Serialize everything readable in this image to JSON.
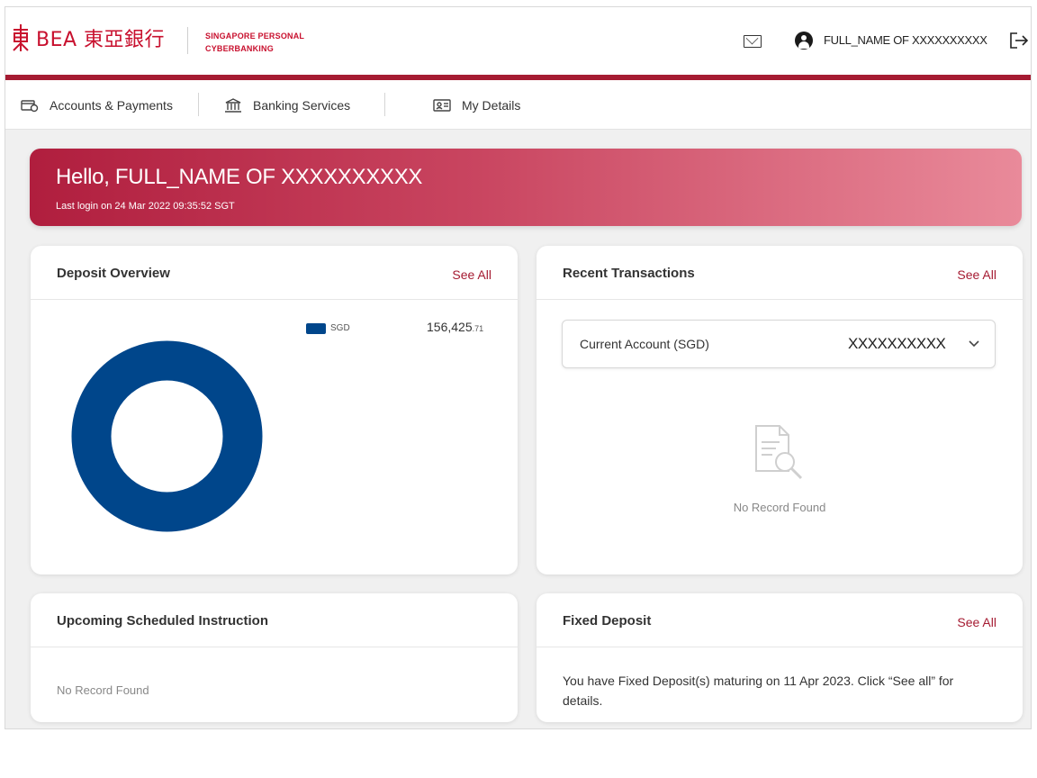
{
  "header": {
    "logo_text": "BEA 東亞銀行",
    "logo_sub_line1": "SINGAPORE PERSONAL",
    "logo_sub_line2": "CYBERBANKING",
    "user_name": "FULL_NAME OF XXXXXXXXXX",
    "icons": [
      "mail-icon",
      "user-icon",
      "logout-icon"
    ]
  },
  "nav": {
    "items": [
      {
        "label": "Accounts & Payments",
        "icon": "wallet-icon"
      },
      {
        "label": "Banking Services",
        "icon": "bank-icon"
      },
      {
        "label": "My Details",
        "icon": "id-card-icon"
      }
    ]
  },
  "banner": {
    "greeting": "Hello, FULL_NAME OF  XXXXXXXXXX",
    "last_login": "Last login on 24 Mar 2022 09:35:52 SGT"
  },
  "deposit_overview": {
    "title": "Deposit Overview",
    "see_all": "See All",
    "legend_label": "SGD",
    "value_main": "156,425",
    "value_cents": ".71",
    "chart_data": {
      "type": "pie",
      "categories": [
        "SGD"
      ],
      "values": [
        156425.71
      ],
      "colors": [
        "#00468b"
      ]
    }
  },
  "recent_transactions": {
    "title": "Recent Transactions",
    "see_all": "See All",
    "account_name": "Current Account (SGD)",
    "account_number": "XXXXXXXXXX",
    "empty_text": "No Record Found"
  },
  "scheduled": {
    "title": "Upcoming Scheduled Instruction",
    "empty_text": "No Record Found"
  },
  "fixed_deposit": {
    "title": "Fixed Deposit",
    "see_all": "See All",
    "message": "You have Fixed Deposit(s) maturing on 11 Apr 2023. Click “See all” for details."
  },
  "colors": {
    "brand_red": "#c8102e",
    "brand_dark_red": "#a51b32",
    "donut_blue": "#00468b"
  }
}
